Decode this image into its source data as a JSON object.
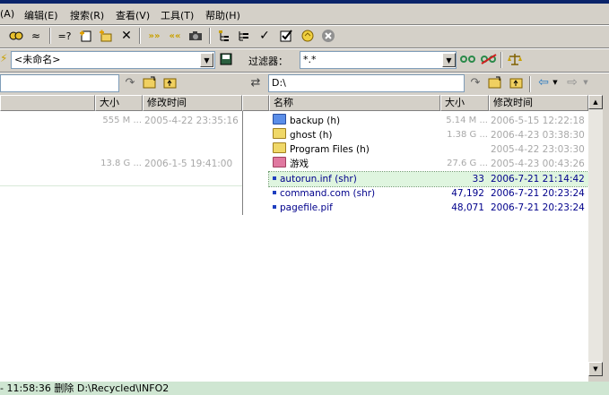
{
  "menu": [
    "(A)",
    "编辑(E)",
    "搜索(R)",
    "查看(V)",
    "工具(T)",
    "帮助(H)"
  ],
  "toolbar": {
    "icons": [
      "sync-icon",
      "compare-icon",
      "equal-icon",
      "new-file-icon",
      "new-folder-icon",
      "delete-icon",
      "expand-all-icon",
      "collapse-all-icon",
      "tree-icon",
      "tree-list-icon",
      "check-icon",
      "check-box-icon",
      "hand-icon",
      "cancel-icon"
    ]
  },
  "session": {
    "name": "<未命名>",
    "filter_label": "过滤器：",
    "filter_value": "*.*"
  },
  "left_panel": {
    "path": "",
    "headers": [
      "大小",
      "修改时间"
    ],
    "rows": [
      {
        "size": "555 M ...",
        "modified": "2005-4-22 23:35:16",
        "style": "gray"
      },
      {
        "size": "",
        "modified": "",
        "style": "gray"
      },
      {
        "size": "",
        "modified": "",
        "style": "gray"
      },
      {
        "size": "13.8 G ...",
        "modified": "2006-1-5 19:41:00",
        "style": "gray"
      }
    ]
  },
  "right_panel": {
    "path": "D:\\",
    "headers": [
      "名称",
      "大小",
      "修改时间"
    ],
    "rows": [
      {
        "name": "backup  (h)",
        "type": "folder",
        "size": "5.14 M ...",
        "modified": "2006-5-15 12:22:18",
        "style": "gray"
      },
      {
        "name": "ghost  (h)",
        "type": "folder",
        "size": "1.38 G ...",
        "modified": "2006-4-23 03:38:30",
        "style": "gray"
      },
      {
        "name": "Program Files  (h)",
        "type": "folder",
        "size": "",
        "modified": "2005-4-22 23:03:30",
        "style": "gray"
      },
      {
        "name": "游戏",
        "type": "folder-pink",
        "size": "27.6 G ...",
        "modified": "2005-4-23 00:43:26",
        "style": "gray"
      },
      {
        "name": "autorun.inf  (shr)",
        "type": "file",
        "size": "33",
        "modified": "2006-7-21 21:14:42",
        "style": "blue"
      },
      {
        "name": "command.com  (shr)",
        "type": "file",
        "size": "47,192",
        "modified": "2006-7-21 20:23:24",
        "style": "blue"
      },
      {
        "name": "pagefile.pif",
        "type": "file",
        "size": "48,071",
        "modified": "2006-7-21 20:23:24",
        "style": "blue"
      }
    ]
  },
  "status": "- 11:58:36  删除 D:\\Recycled\\INFO2",
  "colors": {
    "highlight_row": "#dff5df",
    "status_bg": "#cfe6d2"
  }
}
